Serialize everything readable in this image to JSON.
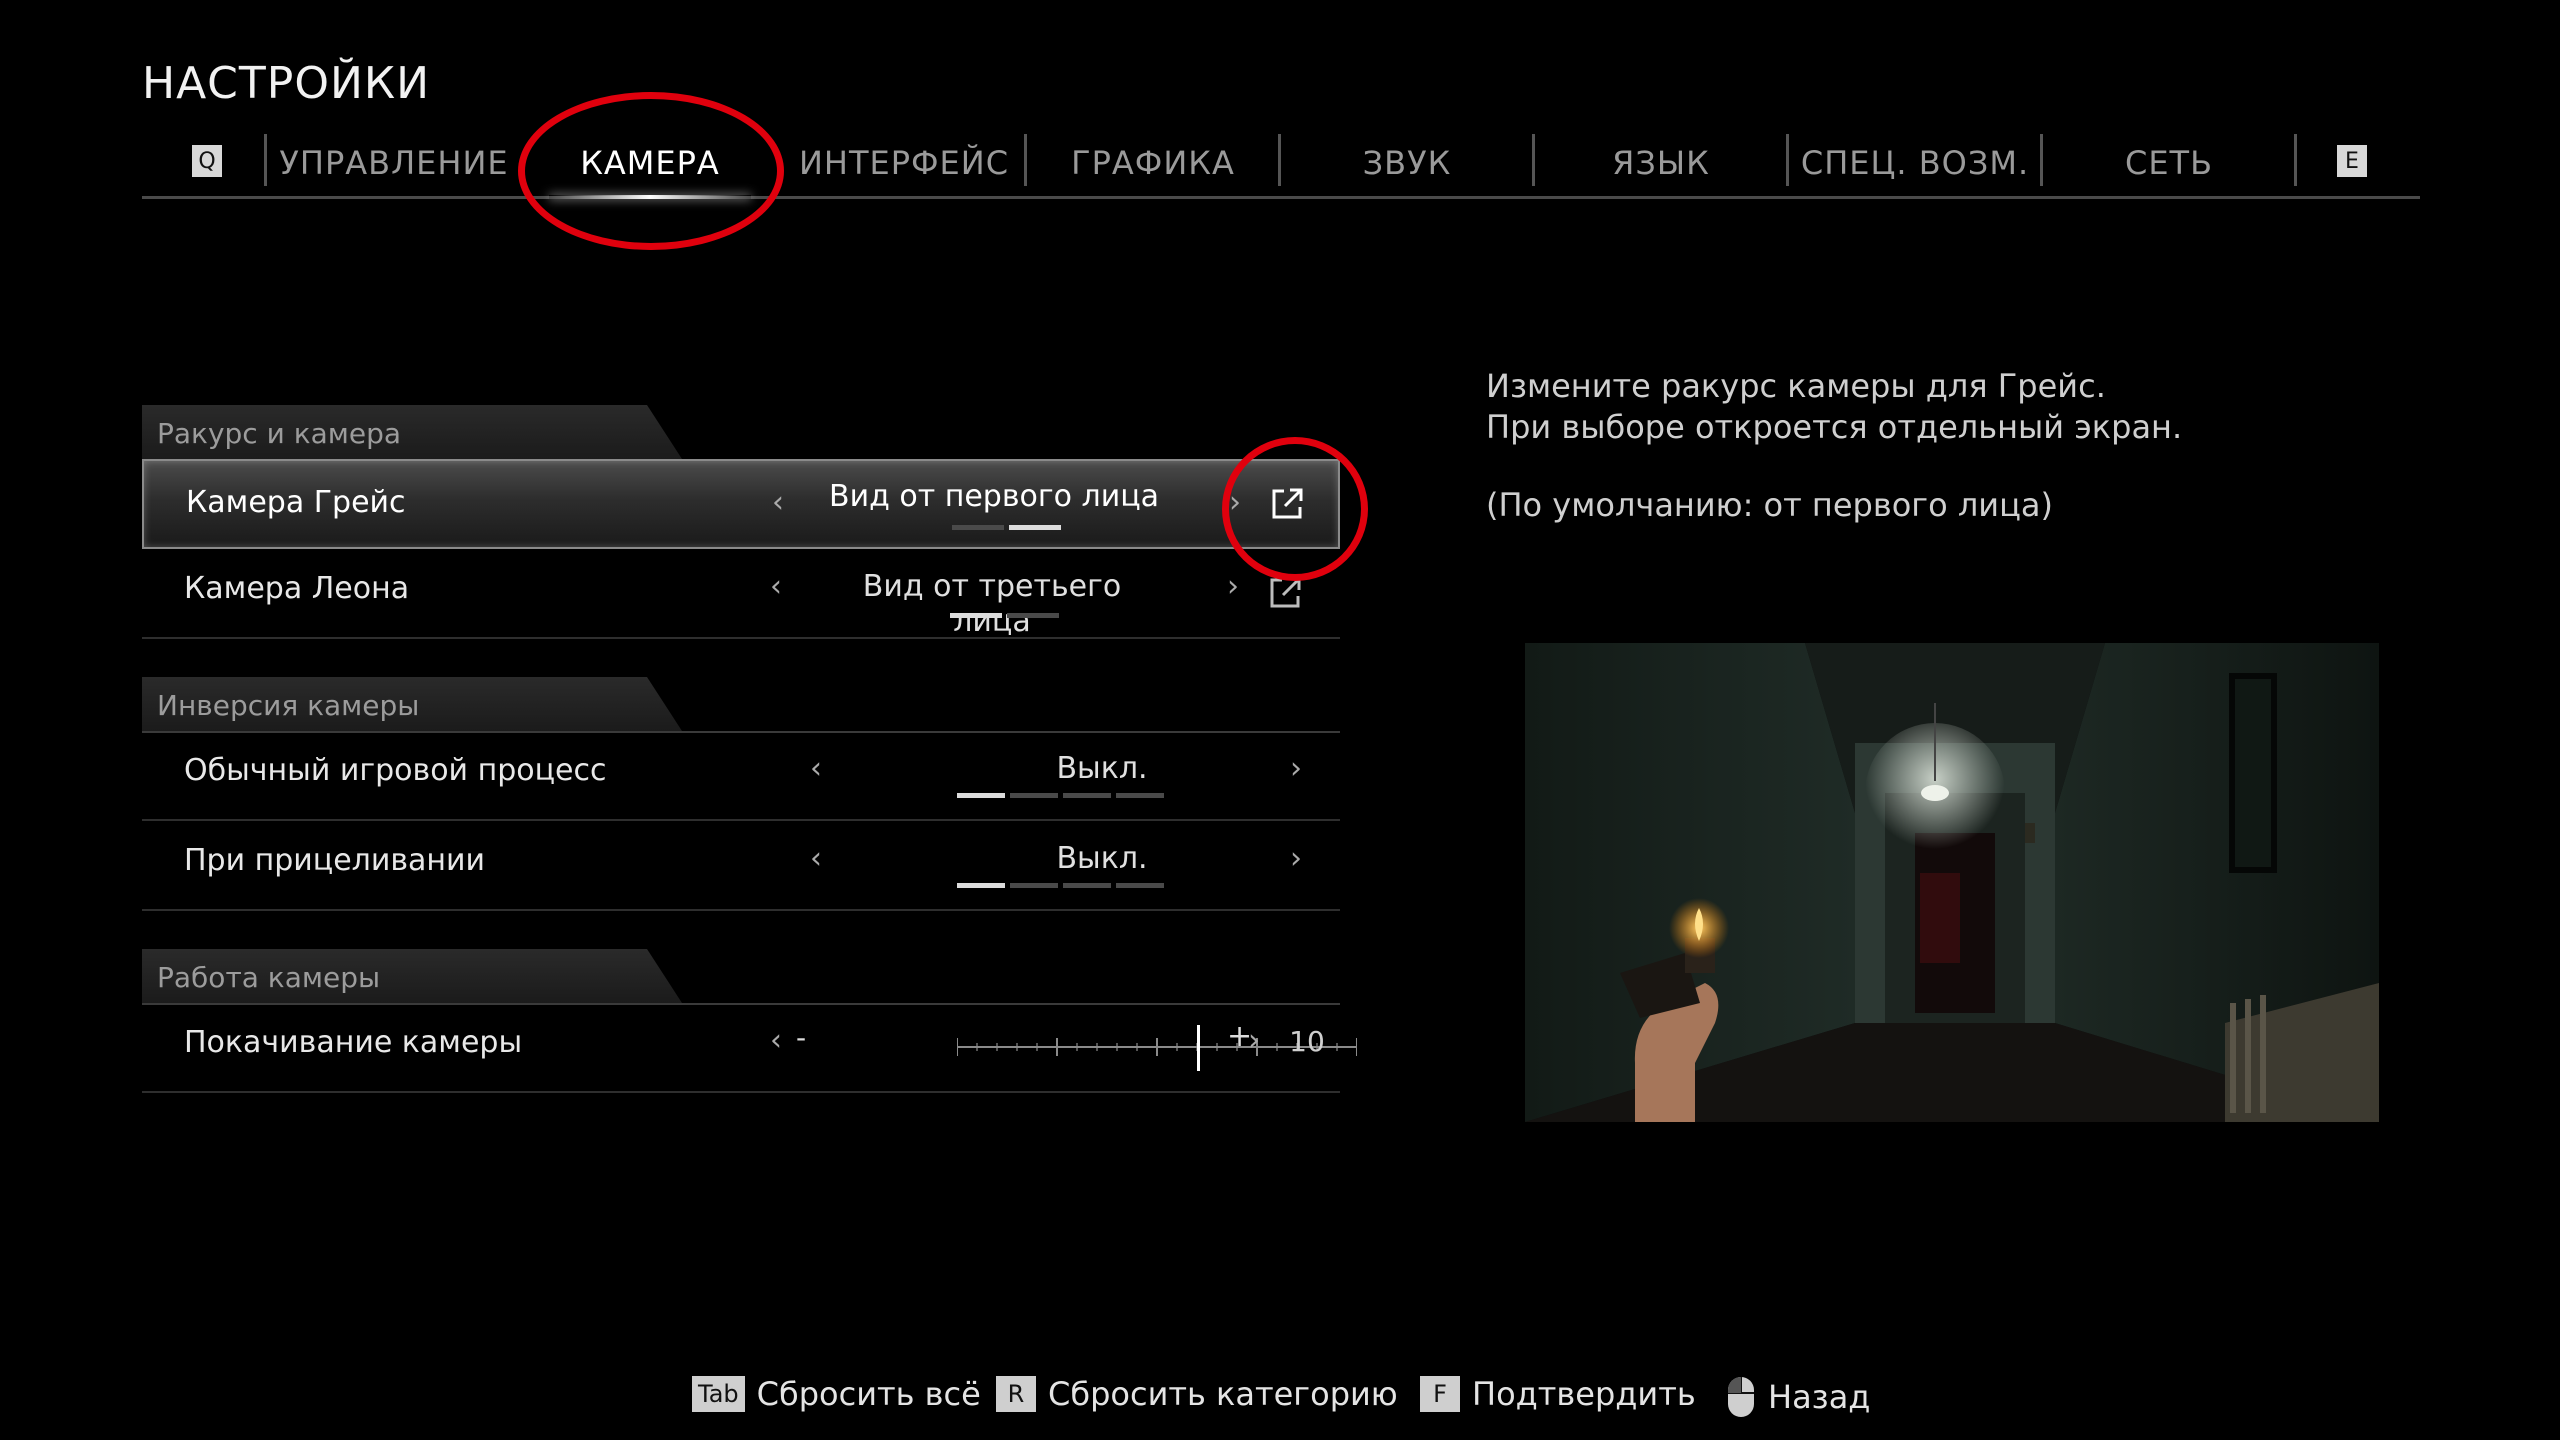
{
  "page_title": "НАСТРОЙКИ",
  "tabs": {
    "prev_key": "Q",
    "next_key": "E",
    "items": [
      {
        "label": "УПРАВЛЕНИЕ"
      },
      {
        "label": "КАМЕРА"
      },
      {
        "label": "ИНТЕРФЕЙС"
      },
      {
        "label": "ГРАФИКА"
      },
      {
        "label": "ЗВУК"
      },
      {
        "label": "ЯЗЫК"
      },
      {
        "label": "СПЕЦ. ВОЗМ."
      },
      {
        "label": "СЕТЬ"
      }
    ],
    "active": "КАМЕРА"
  },
  "sections": [
    {
      "title": "Ракурс и камера",
      "rows": [
        {
          "label": "Камера Грейс",
          "value": "Вид от первого лица",
          "options_total": 2,
          "selected_index": 2,
          "selected": true
        },
        {
          "label": "Камера Леона",
          "value": "Вид от третьего лица",
          "options_total": 2,
          "selected_index": 1,
          "selected": false
        }
      ]
    },
    {
      "title": "Инверсия камеры",
      "rows": [
        {
          "label": "Обычный игровой процесс",
          "value": "Выкл.",
          "options_total": 4,
          "selected_index": 1
        },
        {
          "label": "При прицеливании",
          "value": "Выкл.",
          "options_total": 4,
          "selected_index": 1
        }
      ]
    },
    {
      "title": "Работа камеры",
      "rows": [
        {
          "label": "Покачивание камеры",
          "minus": "-",
          "plus": "+",
          "value": "10",
          "slider_fraction": 0.6
        }
      ]
    }
  ],
  "description": {
    "line1": "Измените ракурс камеры для Грейс.",
    "line2": "При выборе откроется отдельный экран.",
    "default": "(По умолчанию: от первого лица)"
  },
  "footer": [
    {
      "key": "Tab",
      "label": "Сбросить всё"
    },
    {
      "key": "R",
      "label": "Сбросить категорию"
    },
    {
      "key": "F",
      "label": "Подтвердить"
    },
    {
      "key": "mouse-icon",
      "label": "Назад"
    }
  ],
  "colors": {
    "highlight": "#e0000d",
    "accent": "#ffffff"
  }
}
